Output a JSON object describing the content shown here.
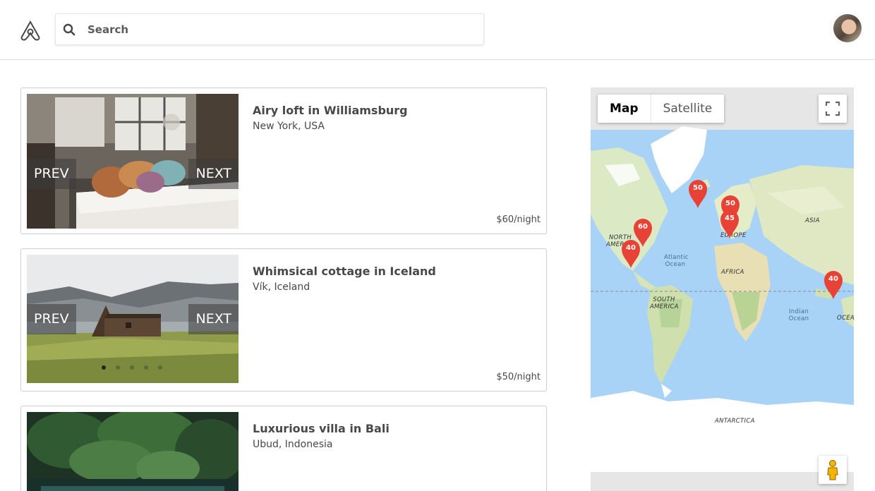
{
  "header": {
    "search": {
      "placeholder": "Search"
    }
  },
  "listings": [
    {
      "title": "Airy loft in Williamsburg",
      "location": "New York, USA",
      "price": "$60/night",
      "prev_label": "PREV",
      "next_label": "NEXT"
    },
    {
      "title": "Whimsical cottage in Iceland",
      "location": "Vík, Iceland",
      "price": "$50/night",
      "prev_label": "PREV",
      "next_label": "NEXT",
      "photo_index": 1,
      "photo_count": 5
    },
    {
      "title": "Luxurious villa in Bali",
      "location": "Ubud, Indonesia"
    }
  ],
  "map": {
    "type_options": [
      "Map",
      "Satellite"
    ],
    "selected_type": "Map",
    "labels": {
      "north_america": "NORTH AMERICA",
      "south_america": "SOUTH AMERICA",
      "europe": "EUROPE",
      "asia": "ASIA",
      "africa": "AFRICA",
      "antarctica": "ANTARCTICA",
      "atlantic": "Atlantic Ocean",
      "indian": "Indian Ocean",
      "ocean_edge": "OCEA"
    },
    "markers": [
      "60",
      "40",
      "50",
      "50",
      "45",
      "40"
    ],
    "colors": {
      "marker": "#e84236",
      "water": "#a9d3f6",
      "land": "#dbe9c4",
      "ice": "#ffffff"
    }
  }
}
